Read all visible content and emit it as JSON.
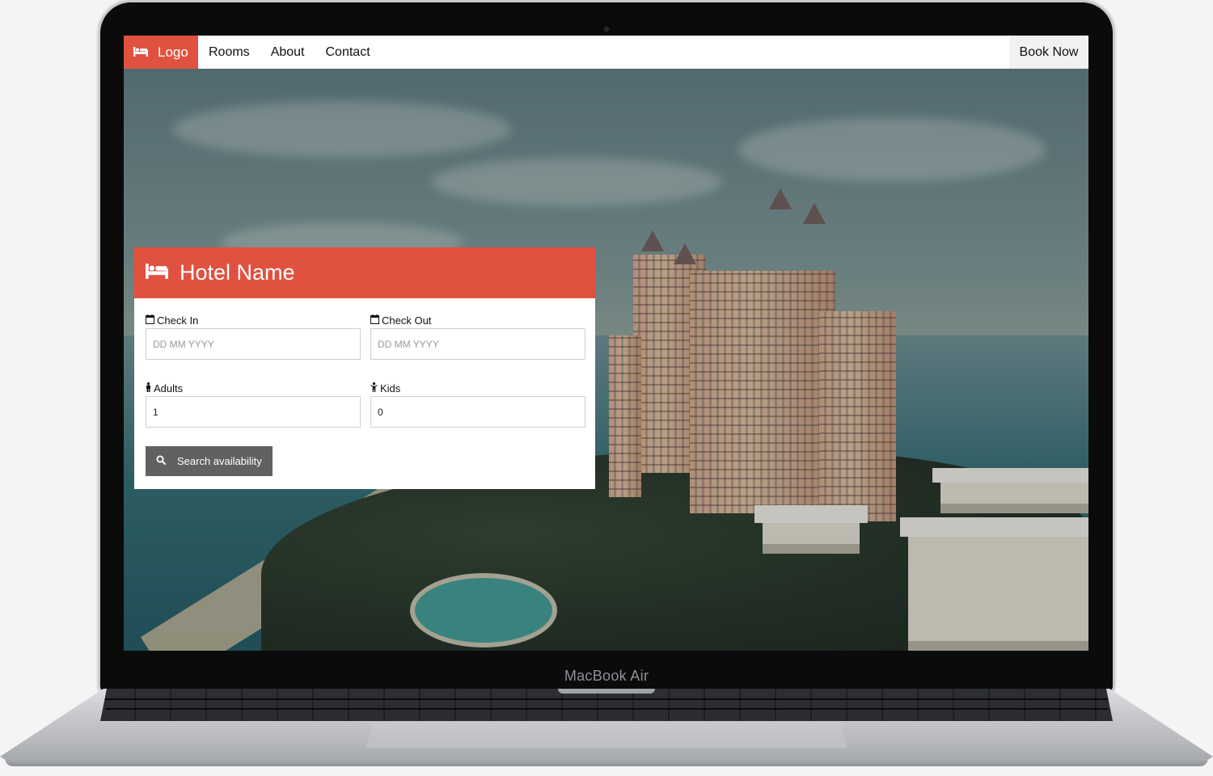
{
  "device": {
    "label": "MacBook Air"
  },
  "navbar": {
    "logo_label": "Logo",
    "links": [
      "Rooms",
      "About",
      "Contact"
    ],
    "cta_label": "Book Now"
  },
  "booking": {
    "title": "Hotel Name",
    "check_in": {
      "label": "Check In",
      "placeholder": "DD MM YYYY"
    },
    "check_out": {
      "label": "Check Out",
      "placeholder": "DD MM YYYY"
    },
    "adults": {
      "label": "Adults",
      "value": "1"
    },
    "kids": {
      "label": "Kids",
      "value": "0"
    },
    "search_label": "Search availability"
  },
  "colors": {
    "accent": "#e0513f",
    "button": "#616161",
    "navbar": "#ffffff"
  },
  "icons": {
    "logo": "bed-icon",
    "title": "bed-icon",
    "check_in": "calendar-icon",
    "check_out": "calendar-icon",
    "adults": "male-icon",
    "kids": "child-icon",
    "search": "search-icon"
  }
}
